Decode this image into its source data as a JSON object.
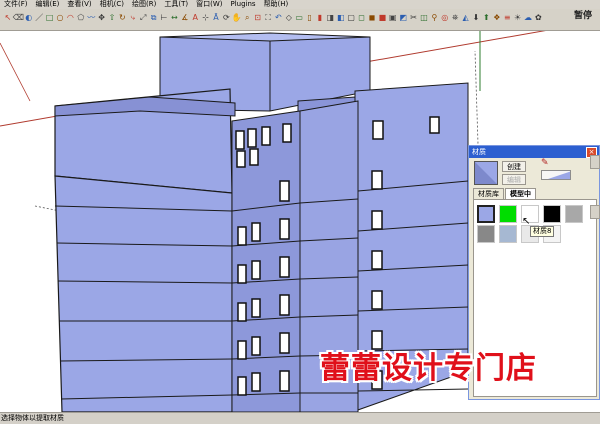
{
  "menu": [
    "文件(F)",
    "编辑(E)",
    "查看(V)",
    "相机(C)",
    "绘图(R)",
    "工具(T)",
    "窗口(W)",
    "Plugins",
    "帮助(H)"
  ],
  "toolbar": {
    "icons": [
      "select-arrow",
      "eraser",
      "paint-bucket",
      "line",
      "rectangle",
      "circle",
      "arc",
      "polygon",
      "freehand",
      "move",
      "push-pull",
      "rotate",
      "follow-me",
      "scale",
      "offset",
      "tape-measure",
      "dimension",
      "protractor",
      "text",
      "axes",
      "3d-text",
      "orbit",
      "pan",
      "zoom",
      "zoom-window",
      "zoom-extents",
      "previous",
      "iso-view",
      "top-view",
      "front-view",
      "right-view",
      "back-view",
      "left-view",
      "x-ray",
      "wireframe",
      "hidden-line",
      "shaded",
      "shaded-texture",
      "monochrome",
      "section-plane",
      "display-section",
      "walk",
      "look-around",
      "position-camera",
      "sandbox",
      "get-models",
      "share-model",
      "component",
      "layer",
      "shadow",
      "fog",
      "style"
    ],
    "right_label": "暂停"
  },
  "status": {
    "text": "选择物体以提取材质"
  },
  "watermark": "蕾蕾设计专门店",
  "materials": {
    "title": "材质",
    "close": "×",
    "create_label": "创建",
    "edit_label": "编辑",
    "tabs": [
      "材质库",
      "模型中"
    ],
    "active_tab": "模型中",
    "tooltip": "材质8",
    "preview_color": "#9ba7e6",
    "swatch_colors": [
      "#9ba7e6",
      "#00dd00",
      "#ffffff",
      "#000000",
      "#a8a8a8",
      "#888888",
      "#a6b8d2",
      "#e9e9e9",
      "#f4f4f4"
    ]
  },
  "colors": {
    "wall": "#9ba7e6",
    "wall_dark": "#7d89cc",
    "edge": "#1a1a1a",
    "axis_red": "#b03a2e",
    "axis_green": "#2f7d2f",
    "accent_blue": "#2c5fd0",
    "watermark_red": "#e0101a"
  }
}
